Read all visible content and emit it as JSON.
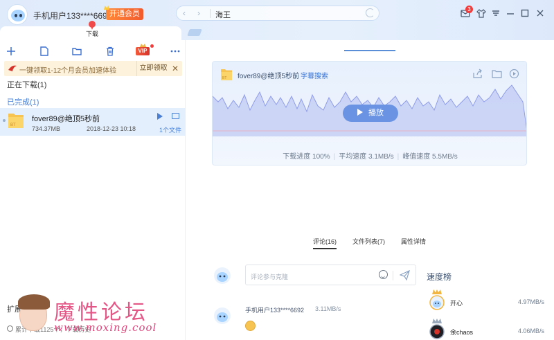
{
  "header": {
    "username": "手机用户133****6692",
    "vip_button": "开通会员",
    "search_query": "海王",
    "message_count": "3"
  },
  "tabs": {
    "download_label": "下载"
  },
  "left": {
    "promo_text": "一键领取1-12个月会员加速体验",
    "promo_button": "立即领取",
    "promo_close": "✕",
    "vip_label": "VIP",
    "downloading_section": "正在下载(1)",
    "completed_section": "已完成(1)",
    "file": {
      "name": "fover89@绝顶5秒前",
      "size": "734.37MB",
      "date": "2018-12-23 10:18",
      "count": "1个文件",
      "type_badge": "BT"
    },
    "experience_title": "扩展箱",
    "experience_sub": "累计下载1125个，下载历史"
  },
  "watermark": {
    "title": "魔性论坛",
    "url": "www.moxing.cool"
  },
  "card": {
    "title": "fover89@绝顶5秒前",
    "subtitle_link": "字幕搜索",
    "play_button": "播放",
    "type_badge": "BT",
    "stat_progress": "下载进度 100%",
    "stat_avg": "平均速度 3.1MB/s",
    "stat_peak": "峰值速度 5.5MB/s"
  },
  "detail_tabs": [
    {
      "label": "评论(16)"
    },
    {
      "label": "文件列表(7)"
    },
    {
      "label": "属性详情"
    }
  ],
  "comments": {
    "input_placeholder": "评论参与克隆",
    "items": [
      {
        "user": "手机用户133****6692",
        "speed": "3.11MB/s"
      }
    ]
  },
  "ranking": {
    "title": "速度榜",
    "rows": [
      {
        "name": "开心",
        "speed": "4.97MB/s"
      },
      {
        "name": "余chaos",
        "speed": "4.06MB/s"
      }
    ]
  },
  "colors": {
    "accent": "#4a7fd6",
    "vip_orange": "#f35a2c",
    "wave_fill": "#c6cff5"
  }
}
